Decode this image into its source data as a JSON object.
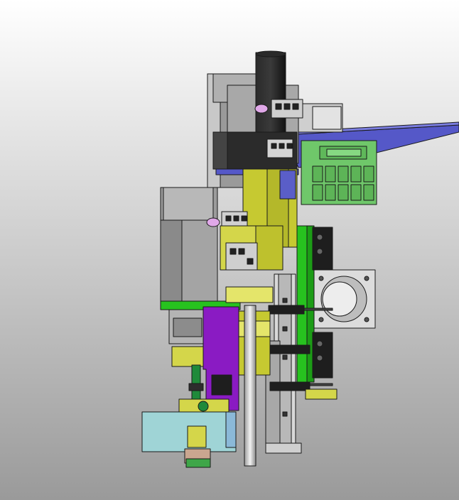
{
  "viewport": {
    "background_top": "#ffffff",
    "background_bottom": "#9a9a9a"
  },
  "palette": {
    "motor_gray": "#8c8c8c",
    "motor_light": "#c8c8c8",
    "motor_dark": "#5e5e5e",
    "black_part": "#1e1e1e",
    "yellow_plate": "#c6c931",
    "yellow_light": "#e4e56a",
    "yellow_dark": "#8d8f1a",
    "green_board": "#6fc76a",
    "green_dark": "#3c8f3a",
    "green_plate": "#27c21f",
    "blue_bar": "#5558c8",
    "purple_bracket": "#8a1bc3",
    "cyan_block": "#9fd4d6",
    "pink_cap": "#e0a8e8",
    "rod_silver": "#d6d6d6",
    "edge": "#1a1a1a"
  }
}
